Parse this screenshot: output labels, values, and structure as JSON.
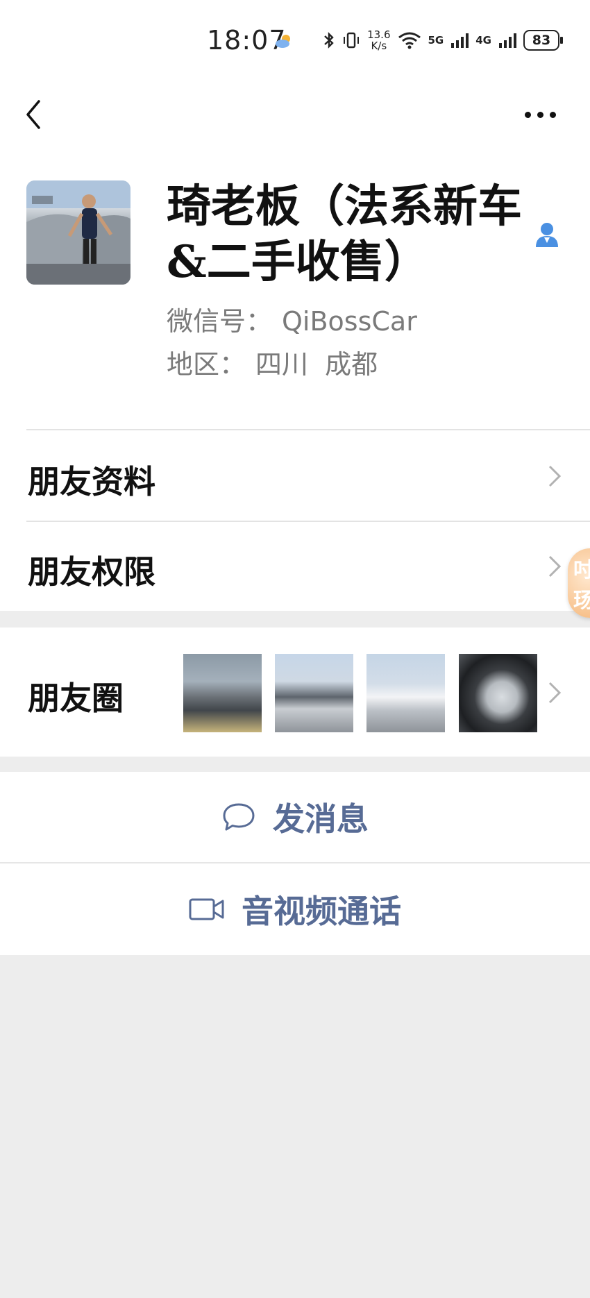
{
  "status_bar": {
    "time": "18:07",
    "net_speed_value": "13.6",
    "net_speed_unit": "K/s",
    "signal_1_label": "5G",
    "signal_2_label": "4G",
    "battery": "83"
  },
  "profile": {
    "nickname": "琦老板（法系新车&二手收售）",
    "wechat_id_label": "微信号：",
    "wechat_id": "QiBossCar",
    "region_label": "地区：",
    "region": "四川  成都"
  },
  "menu": {
    "friend_info": "朋友资料",
    "friend_permissions": "朋友权限",
    "moments": "朋友圈"
  },
  "floating_badge": {
    "line1": "吋",
    "line2": "玚"
  },
  "actions": {
    "send_message": "发消息",
    "video_call": "音视频通话"
  },
  "colors": {
    "link_blue": "#576b95",
    "contact_icon_blue": "#4a90e2",
    "background": "#ededed"
  }
}
